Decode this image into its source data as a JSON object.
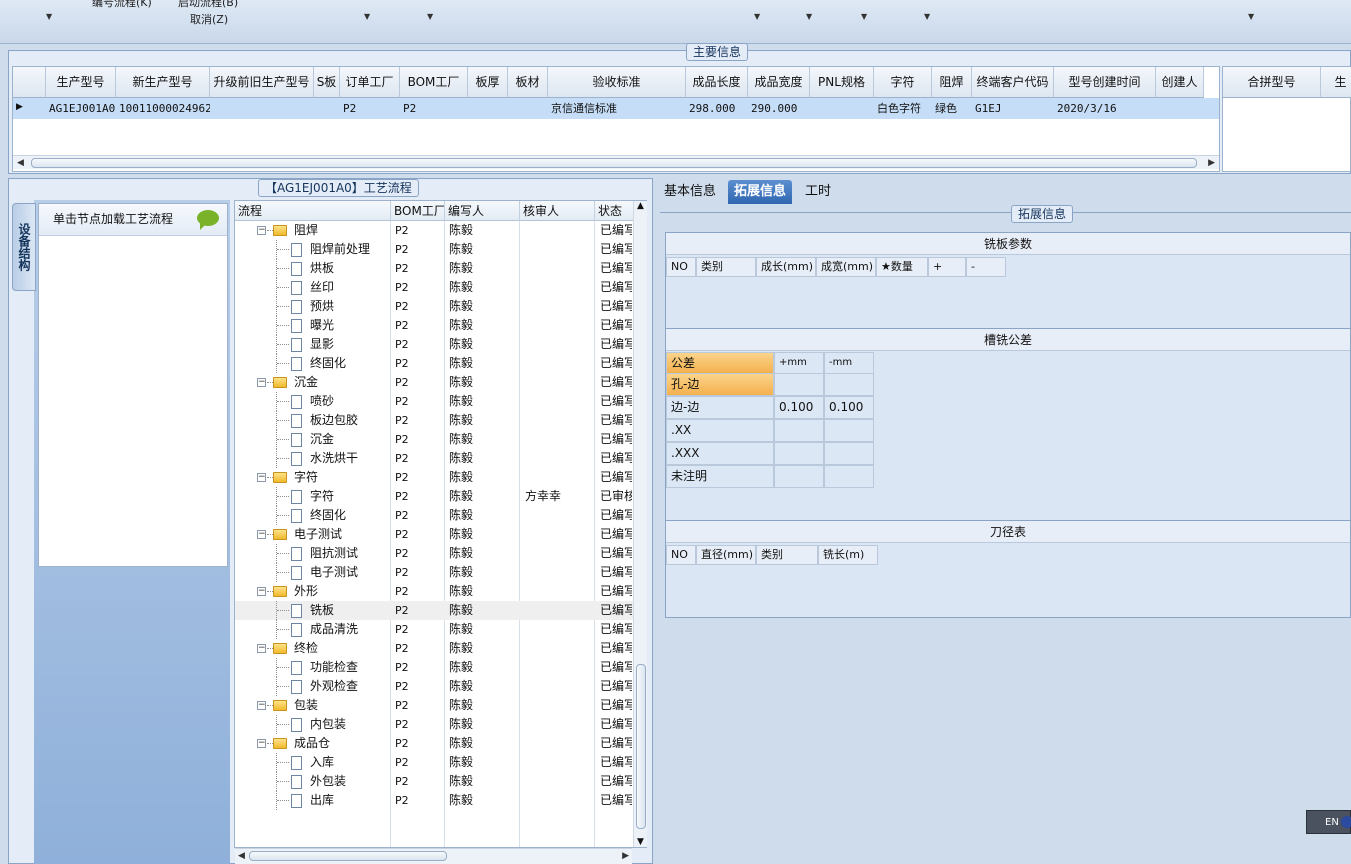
{
  "toolbar": {
    "item1": "编号流程(K)",
    "item2": "启动流程(B)",
    "cancel": "取消(Z)"
  },
  "main_info": {
    "title": "主要信息",
    "columns": [
      "生产型号",
      "新生产型号",
      "升级前旧生产型号",
      "S板",
      "订单工厂",
      "BOM工厂",
      "板厚",
      "板材",
      "验收标准",
      "成品长度",
      "成品宽度",
      "PNL规格",
      "字符",
      "阻焊",
      "终端客户代码",
      "型号创建时间",
      "创建人"
    ],
    "row": [
      "AG1EJ001A0",
      "10011000024962",
      "",
      "",
      "P2",
      "P2",
      "",
      "",
      "京信通信标准",
      "298.000",
      "290.000",
      "",
      "白色字符",
      "绿色",
      "G1EJ",
      "2020/3/16",
      ""
    ],
    "right_columns": [
      "合拼型号",
      "生"
    ]
  },
  "process": {
    "title": "【AG1EJ001A0】工艺流程",
    "side_tab": "设备结构",
    "panel_header": "单击节点加载工艺流程",
    "columns": [
      "流程",
      "BOM工厂",
      "编写人",
      "核审人",
      "状态"
    ],
    "rows": [
      {
        "level": 0,
        "name": "阻焊",
        "bom": "P2",
        "writer": "陈毅",
        "reviewer": "",
        "status": "已编写"
      },
      {
        "level": 1,
        "name": "阻焊前处理",
        "bom": "P2",
        "writer": "陈毅",
        "reviewer": "",
        "status": "已编写"
      },
      {
        "level": 1,
        "name": "烘板",
        "bom": "P2",
        "writer": "陈毅",
        "reviewer": "",
        "status": "已编写"
      },
      {
        "level": 1,
        "name": "丝印",
        "bom": "P2",
        "writer": "陈毅",
        "reviewer": "",
        "status": "已编写"
      },
      {
        "level": 1,
        "name": "预烘",
        "bom": "P2",
        "writer": "陈毅",
        "reviewer": "",
        "status": "已编写"
      },
      {
        "level": 1,
        "name": "曝光",
        "bom": "P2",
        "writer": "陈毅",
        "reviewer": "",
        "status": "已编写"
      },
      {
        "level": 1,
        "name": "显影",
        "bom": "P2",
        "writer": "陈毅",
        "reviewer": "",
        "status": "已编写"
      },
      {
        "level": 1,
        "name": "终固化",
        "bom": "P2",
        "writer": "陈毅",
        "reviewer": "",
        "status": "已编写"
      },
      {
        "level": 0,
        "name": "沉金",
        "bom": "P2",
        "writer": "陈毅",
        "reviewer": "",
        "status": "已编写"
      },
      {
        "level": 1,
        "name": "喷砂",
        "bom": "P2",
        "writer": "陈毅",
        "reviewer": "",
        "status": "已编写"
      },
      {
        "level": 1,
        "name": "板边包胶",
        "bom": "P2",
        "writer": "陈毅",
        "reviewer": "",
        "status": "已编写"
      },
      {
        "level": 1,
        "name": "沉金",
        "bom": "P2",
        "writer": "陈毅",
        "reviewer": "",
        "status": "已编写"
      },
      {
        "level": 1,
        "name": "水洗烘干",
        "bom": "P2",
        "writer": "陈毅",
        "reviewer": "",
        "status": "已编写"
      },
      {
        "level": 0,
        "name": "字符",
        "bom": "P2",
        "writer": "陈毅",
        "reviewer": "",
        "status": "已编写"
      },
      {
        "level": 1,
        "name": "字符",
        "bom": "P2",
        "writer": "陈毅",
        "reviewer": "方幸幸",
        "status": "已审核"
      },
      {
        "level": 1,
        "name": "终固化",
        "bom": "P2",
        "writer": "陈毅",
        "reviewer": "",
        "status": "已编写"
      },
      {
        "level": 0,
        "name": "电子测试",
        "bom": "P2",
        "writer": "陈毅",
        "reviewer": "",
        "status": "已编写"
      },
      {
        "level": 1,
        "name": "阻抗测试",
        "bom": "P2",
        "writer": "陈毅",
        "reviewer": "",
        "status": "已编写"
      },
      {
        "level": 1,
        "name": "电子测试",
        "bom": "P2",
        "writer": "陈毅",
        "reviewer": "",
        "status": "已编写"
      },
      {
        "level": 0,
        "name": "外形",
        "bom": "P2",
        "writer": "陈毅",
        "reviewer": "",
        "status": "已编写"
      },
      {
        "level": 1,
        "name": "铣板",
        "bom": "P2",
        "writer": "陈毅",
        "reviewer": "",
        "status": "已编写",
        "highlight": true
      },
      {
        "level": 1,
        "name": "成品清洗",
        "bom": "P2",
        "writer": "陈毅",
        "reviewer": "",
        "status": "已编写"
      },
      {
        "level": 0,
        "name": "终检",
        "bom": "P2",
        "writer": "陈毅",
        "reviewer": "",
        "status": "已编写"
      },
      {
        "level": 1,
        "name": "功能检查",
        "bom": "P2",
        "writer": "陈毅",
        "reviewer": "",
        "status": "已编写"
      },
      {
        "level": 1,
        "name": "外观检查",
        "bom": "P2",
        "writer": "陈毅",
        "reviewer": "",
        "status": "已编写"
      },
      {
        "level": 0,
        "name": "包装",
        "bom": "P2",
        "writer": "陈毅",
        "reviewer": "",
        "status": "已编写"
      },
      {
        "level": 1,
        "name": "内包装",
        "bom": "P2",
        "writer": "陈毅",
        "reviewer": "",
        "status": "已编写"
      },
      {
        "level": 0,
        "name": "成品仓",
        "bom": "P2",
        "writer": "陈毅",
        "reviewer": "",
        "status": "已编写"
      },
      {
        "level": 1,
        "name": "入库",
        "bom": "P2",
        "writer": "陈毅",
        "reviewer": "",
        "status": "已编写"
      },
      {
        "level": 1,
        "name": "外包装",
        "bom": "P2",
        "writer": "陈毅",
        "reviewer": "",
        "status": "已编写"
      },
      {
        "level": 1,
        "name": "出库",
        "bom": "P2",
        "writer": "陈毅",
        "reviewer": "",
        "status": "已编写"
      }
    ]
  },
  "tabs": [
    "基本信息",
    "拓展信息",
    "工时"
  ],
  "ext": {
    "title": "拓展信息",
    "mill_params": {
      "title": "铣板参数",
      "columns": [
        "NO",
        "类别",
        "成长(mm)",
        "成宽(mm)",
        "★数量",
        "+",
        "-"
      ]
    },
    "slot_tolerance": {
      "title": "槽铣公差",
      "header": [
        "公差",
        "+mm",
        "-mm"
      ],
      "rows": [
        [
          "孔-边",
          "",
          ""
        ],
        [
          "边-边",
          "0.100",
          "0.100"
        ],
        [
          ".XX",
          "",
          ""
        ],
        [
          ".XXX",
          "",
          ""
        ],
        [
          "未注明",
          "",
          ""
        ]
      ]
    },
    "tool_table": {
      "title": "刀径表",
      "columns": [
        "NO",
        "直径(mm)",
        "类别",
        "铣长(m)"
      ]
    }
  },
  "ime": "EN"
}
